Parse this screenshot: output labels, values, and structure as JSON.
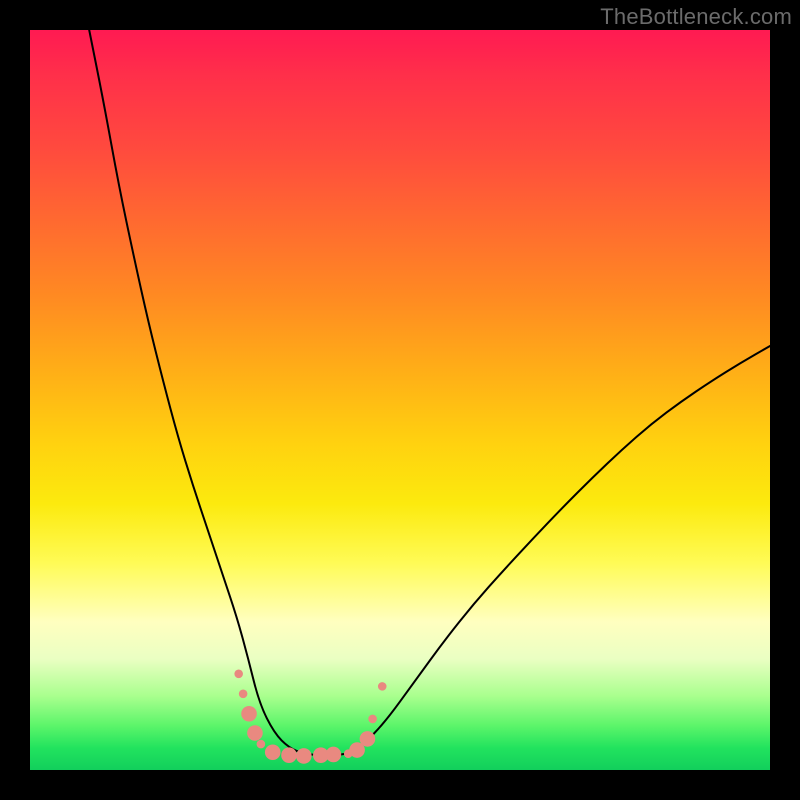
{
  "watermark": "TheBottleneck.com",
  "chart_data": {
    "type": "line",
    "title": "",
    "xlabel": "",
    "ylabel": "",
    "xlim": [
      0,
      100
    ],
    "ylim": [
      0,
      100
    ],
    "grid": false,
    "series": [
      {
        "name": "bottleneck-curve",
        "x": [
          8,
          10,
          12,
          14,
          16,
          18,
          20,
          22,
          24,
          26,
          28,
          29.5,
          31,
          33,
          35,
          37,
          39,
          41,
          43,
          45,
          48,
          52,
          56,
          60,
          64,
          68,
          72,
          76,
          80,
          84,
          88,
          92,
          96,
          100
        ],
        "values": [
          100,
          90,
          79,
          69.5,
          60.5,
          52.5,
          45,
          38.5,
          32.5,
          26.5,
          20.5,
          15,
          9,
          5,
          3,
          2.2,
          2,
          2,
          2.2,
          3.4,
          6.5,
          12,
          17.5,
          22.5,
          27,
          31.3,
          35.5,
          39.5,
          43.3,
          46.8,
          49.8,
          52.5,
          55,
          57.3
        ]
      }
    ],
    "markers": {
      "name": "highlighted-points",
      "color": "#e98980",
      "radius_small": 4.3,
      "radius_large": 7.8,
      "points": [
        {
          "x": 28.2,
          "y": 13.0,
          "r": "small"
        },
        {
          "x": 28.8,
          "y": 10.3,
          "r": "small"
        },
        {
          "x": 29.6,
          "y": 7.6,
          "r": "large"
        },
        {
          "x": 30.4,
          "y": 5.0,
          "r": "large"
        },
        {
          "x": 31.2,
          "y": 3.5,
          "r": "small"
        },
        {
          "x": 32.8,
          "y": 2.4,
          "r": "large"
        },
        {
          "x": 35.0,
          "y": 2.0,
          "r": "large"
        },
        {
          "x": 37.0,
          "y": 1.9,
          "r": "large"
        },
        {
          "x": 39.3,
          "y": 2.0,
          "r": "large"
        },
        {
          "x": 41.0,
          "y": 2.1,
          "r": "large"
        },
        {
          "x": 43.0,
          "y": 2.2,
          "r": "small"
        },
        {
          "x": 44.2,
          "y": 2.7,
          "r": "large"
        },
        {
          "x": 45.6,
          "y": 4.2,
          "r": "large"
        },
        {
          "x": 46.3,
          "y": 6.9,
          "r": "small"
        },
        {
          "x": 47.6,
          "y": 11.3,
          "r": "small"
        }
      ]
    },
    "background_gradient": {
      "top": "#ff1a52",
      "mid_upper": "#ff8a22",
      "mid": "#fcea0e",
      "mid_lower": "#ffffc0",
      "bottom": "#12cf5c"
    }
  }
}
